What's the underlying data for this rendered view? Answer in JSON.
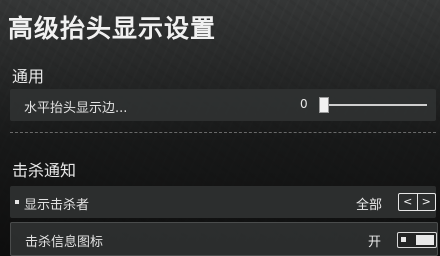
{
  "page": {
    "title": "高级抬头显示设置"
  },
  "sections": [
    {
      "label": "通用",
      "rows": [
        {
          "label": "水平抬头显示边...",
          "control": "slider",
          "value": "0",
          "level": 0
        }
      ]
    },
    {
      "label": "击杀通知",
      "rows": [
        {
          "label": "显示击杀者",
          "control": "selector",
          "value": "全部",
          "left_arrow": "<",
          "right_arrow": ">"
        },
        {
          "label": "击杀信息图标",
          "control": "toggle",
          "value": "开",
          "on": true
        }
      ]
    }
  ]
}
